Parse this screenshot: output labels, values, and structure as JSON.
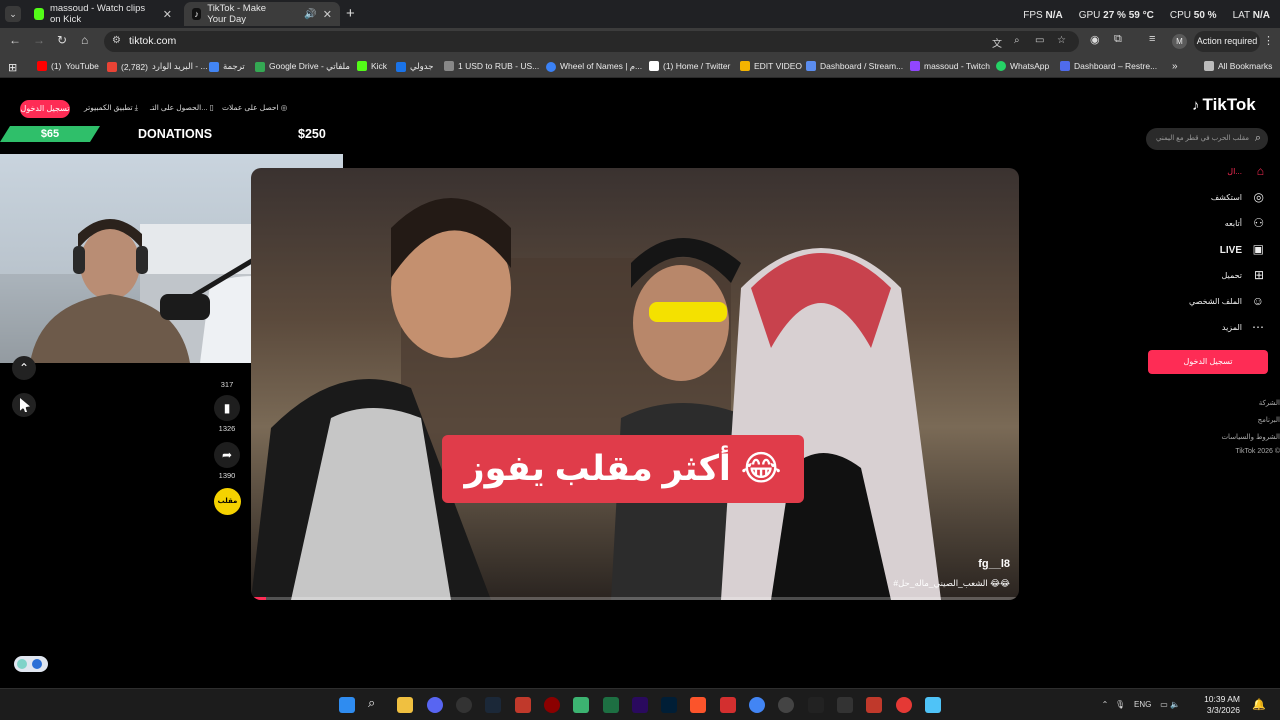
{
  "browser": {
    "tabs": [
      {
        "title": "massoud - Watch clips on Kick",
        "icon": "kick-icon",
        "color": "#53fc18"
      },
      {
        "title": "TikTok - Make Your Day",
        "icon": "tiktok-icon",
        "color": "#ffffff"
      }
    ],
    "new_tab": "+",
    "url": "tiktok.com",
    "action_required": "Action required",
    "profile_initial": "M"
  },
  "stats": {
    "fps_label": "FPS",
    "fps_value": "N/A",
    "gpu_label": "GPU",
    "gpu_value": "27 %",
    "gpu_temp": "59 °C",
    "cpu_label": "CPU",
    "cpu_value": "50 %",
    "lat_label": "LAT",
    "lat_value": "N/A"
  },
  "bookmarks": [
    {
      "label": "YouTube",
      "prefix": "(1)",
      "color": "#ff0000"
    },
    {
      "label": "البريد الوارد - ...",
      "prefix": "(2,782)",
      "color": "#ea4335"
    },
    {
      "label": "ترجمة",
      "color": "#4285f4"
    },
    {
      "label": "Google Drive - ملفاتي",
      "color": "#34a853"
    },
    {
      "label": "Kick",
      "color": "#53fc18"
    },
    {
      "label": "جدولي",
      "color": "#1a73e8"
    },
    {
      "label": "1 USD to RUB - US...",
      "color": "#888888"
    },
    {
      "label": "Wheel of Names | م...",
      "color": "#3b82f6"
    },
    {
      "label": "(1) Home / Twitter",
      "color": "#ffffff"
    },
    {
      "label": "EDIT VIDEO",
      "color": "#f4b400"
    },
    {
      "label": "Dashboard / Stream...",
      "color": "#5b8def"
    },
    {
      "label": "massoud - Twitch",
      "color": "#9146ff"
    },
    {
      "label": "WhatsApp",
      "color": "#25d366"
    },
    {
      "label": "Dashboard – Restre...",
      "color": "#4f6bed"
    },
    {
      "label": "All Bookmarks",
      "color": "#bbbbbb"
    }
  ],
  "tiktok": {
    "logo_text": "TikTok",
    "top_login": "تسجيل الدخول",
    "pc_app": "تطبيق الكمبيوتر",
    "get_app": "الحصول على التـ...",
    "coins": "احصل على عملات",
    "search_placeholder": "مقلب الحرب في قطر مع اليمني",
    "nav": [
      {
        "label": "ال...",
        "icon": "home-icon",
        "glyph": "⌂"
      },
      {
        "label": "استكشف",
        "icon": "compass-icon",
        "glyph": "◎"
      },
      {
        "label": "أتابعه",
        "icon": "follow-user-icon",
        "glyph": "⚇"
      },
      {
        "label": "LIVE",
        "icon": "live-icon",
        "glyph": "▣"
      },
      {
        "label": "تحميل",
        "icon": "upload-icon",
        "glyph": "⊞"
      },
      {
        "label": "الملف الشخصي",
        "icon": "profile-icon",
        "glyph": "☺"
      },
      {
        "label": "المزيد",
        "icon": "more-icon",
        "glyph": "⋯"
      }
    ],
    "side_login": "تسجيل الدخول",
    "footer": [
      "الشركة",
      "البرنامج",
      "الشروط والسياسات",
      "TikTok 2026 ©"
    ],
    "video": {
      "caption": "أكثر مقلب يفوز 😂",
      "author": "fg__l8",
      "hashtag": "#الشعب_الصيني_ماله_حل 😂😂",
      "progress": 0.02
    },
    "actions": [
      {
        "name": "likes",
        "count": "317",
        "icon": "heart-icon",
        "glyph": "♥"
      },
      {
        "name": "favorites",
        "count": "1326",
        "icon": "bookmark-icon",
        "glyph": "🔖"
      },
      {
        "name": "shares",
        "count": "1390",
        "icon": "share-icon",
        "glyph": "➦"
      }
    ],
    "music_label": "مقلب"
  },
  "donations": {
    "current": "$65",
    "title": "DONATIONS",
    "goal": "$250"
  },
  "taskbar": {
    "lang": "ENG",
    "time": "10:39 AM",
    "date": "3/3/2026"
  }
}
